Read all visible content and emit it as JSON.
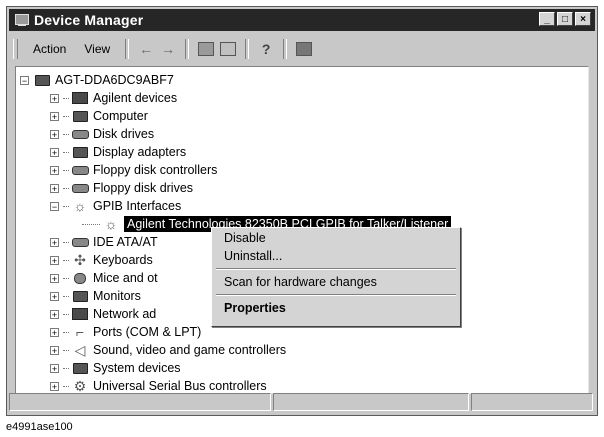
{
  "window": {
    "title": "Device Manager",
    "buttons": [
      "_",
      "□",
      "×"
    ]
  },
  "menu": {
    "items": [
      "Action",
      "View"
    ]
  },
  "toolbar": {
    "icons": [
      "back-arrow-icon",
      "forward-arrow-icon",
      "properties-icon",
      "view-icon",
      "help-icon",
      "scan-icon"
    ]
  },
  "tree": {
    "root": "AGT-DDA6DC9ABF7",
    "items": [
      {
        "label": "Agilent devices",
        "icon": "agilent-device-icon"
      },
      {
        "label": "Computer",
        "icon": "computer-icon"
      },
      {
        "label": "Disk drives",
        "icon": "disk-drive-icon"
      },
      {
        "label": "Display adapters",
        "icon": "display-adapter-icon"
      },
      {
        "label": "Floppy disk controllers",
        "icon": "floppy-controller-icon"
      },
      {
        "label": "Floppy disk drives",
        "icon": "floppy-drive-icon"
      },
      {
        "label": "GPIB Interfaces",
        "icon": "gpib-icon"
      },
      {
        "label": "Agilent Technologies 82350B PCI GPIB for Talker/Listener",
        "icon": "gpib-device-icon"
      },
      {
        "label": "IDE ATA/AT",
        "icon": "ide-controller-icon"
      },
      {
        "label": "Keyboards",
        "icon": "keyboard-icon"
      },
      {
        "label": "Mice and ot",
        "icon": "mouse-icon"
      },
      {
        "label": "Monitors",
        "icon": "monitor-icon"
      },
      {
        "label": "Network ad",
        "icon": "network-adapter-icon"
      },
      {
        "label": "Ports (COM & LPT)",
        "icon": "port-icon"
      },
      {
        "label": "Sound, video and game controllers",
        "icon": "sound-icon"
      },
      {
        "label": "System devices",
        "icon": "system-device-icon"
      },
      {
        "label": "Universal Serial Bus controllers",
        "icon": "usb-icon"
      }
    ]
  },
  "context_menu": {
    "disable": "Disable",
    "uninstall": "Uninstall...",
    "scan": "Scan for hardware changes",
    "properties": "Properties"
  },
  "caption": "e4991ase100"
}
